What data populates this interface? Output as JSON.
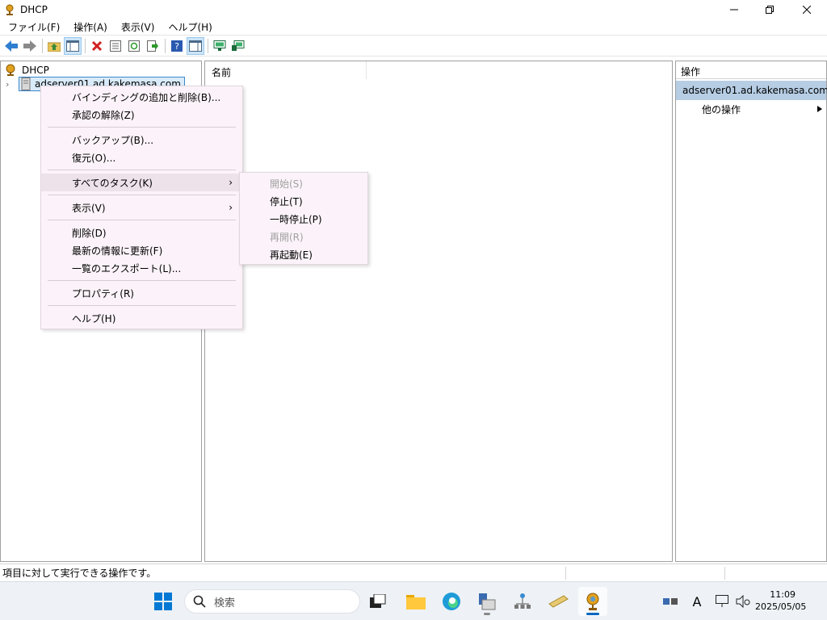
{
  "window": {
    "title": "DHCP"
  },
  "menubar": [
    "ファイル(F)",
    "操作(A)",
    "表示(V)",
    "ヘルプ(H)"
  ],
  "tree": {
    "root": "DHCP",
    "server": "adserver01.ad.kakemasa.com"
  },
  "list": {
    "column_name": "名前"
  },
  "actions": {
    "header": "操作",
    "server": "adserver01.ad.kakemasa.com",
    "more": "他の操作"
  },
  "context_menu": {
    "items": [
      "バインディングの追加と削除(B)...",
      "承認の解除(Z)",
      "バックアップ(B)...",
      "復元(O)...",
      "すべてのタスク(K)",
      "表示(V)",
      "削除(D)",
      "最新の情報に更新(F)",
      "一覧のエクスポート(L)...",
      "プロパティ(R)",
      "ヘルプ(H)"
    ]
  },
  "submenu": {
    "items": [
      {
        "label": "開始(S)",
        "enabled": false
      },
      {
        "label": "停止(T)",
        "enabled": true
      },
      {
        "label": "一時停止(P)",
        "enabled": true
      },
      {
        "label": "再開(R)",
        "enabled": false
      },
      {
        "label": "再起動(E)",
        "enabled": true
      }
    ]
  },
  "statusbar": {
    "text": "項目に対して実行できる操作です。"
  },
  "taskbar": {
    "search_placeholder": "検索",
    "time": "11:09",
    "date": "2025/05/05",
    "ime": "A",
    "apps": [
      "start-icon",
      "task-view-icon",
      "file-explorer-icon",
      "edge-icon",
      "server-manager-icon",
      "network-icon",
      "tools-icon",
      "dhcp-icon"
    ]
  },
  "colors": {
    "accent": "#0067c0",
    "selection": "#b6cde4",
    "menu_bg": "#fbf3f9"
  }
}
